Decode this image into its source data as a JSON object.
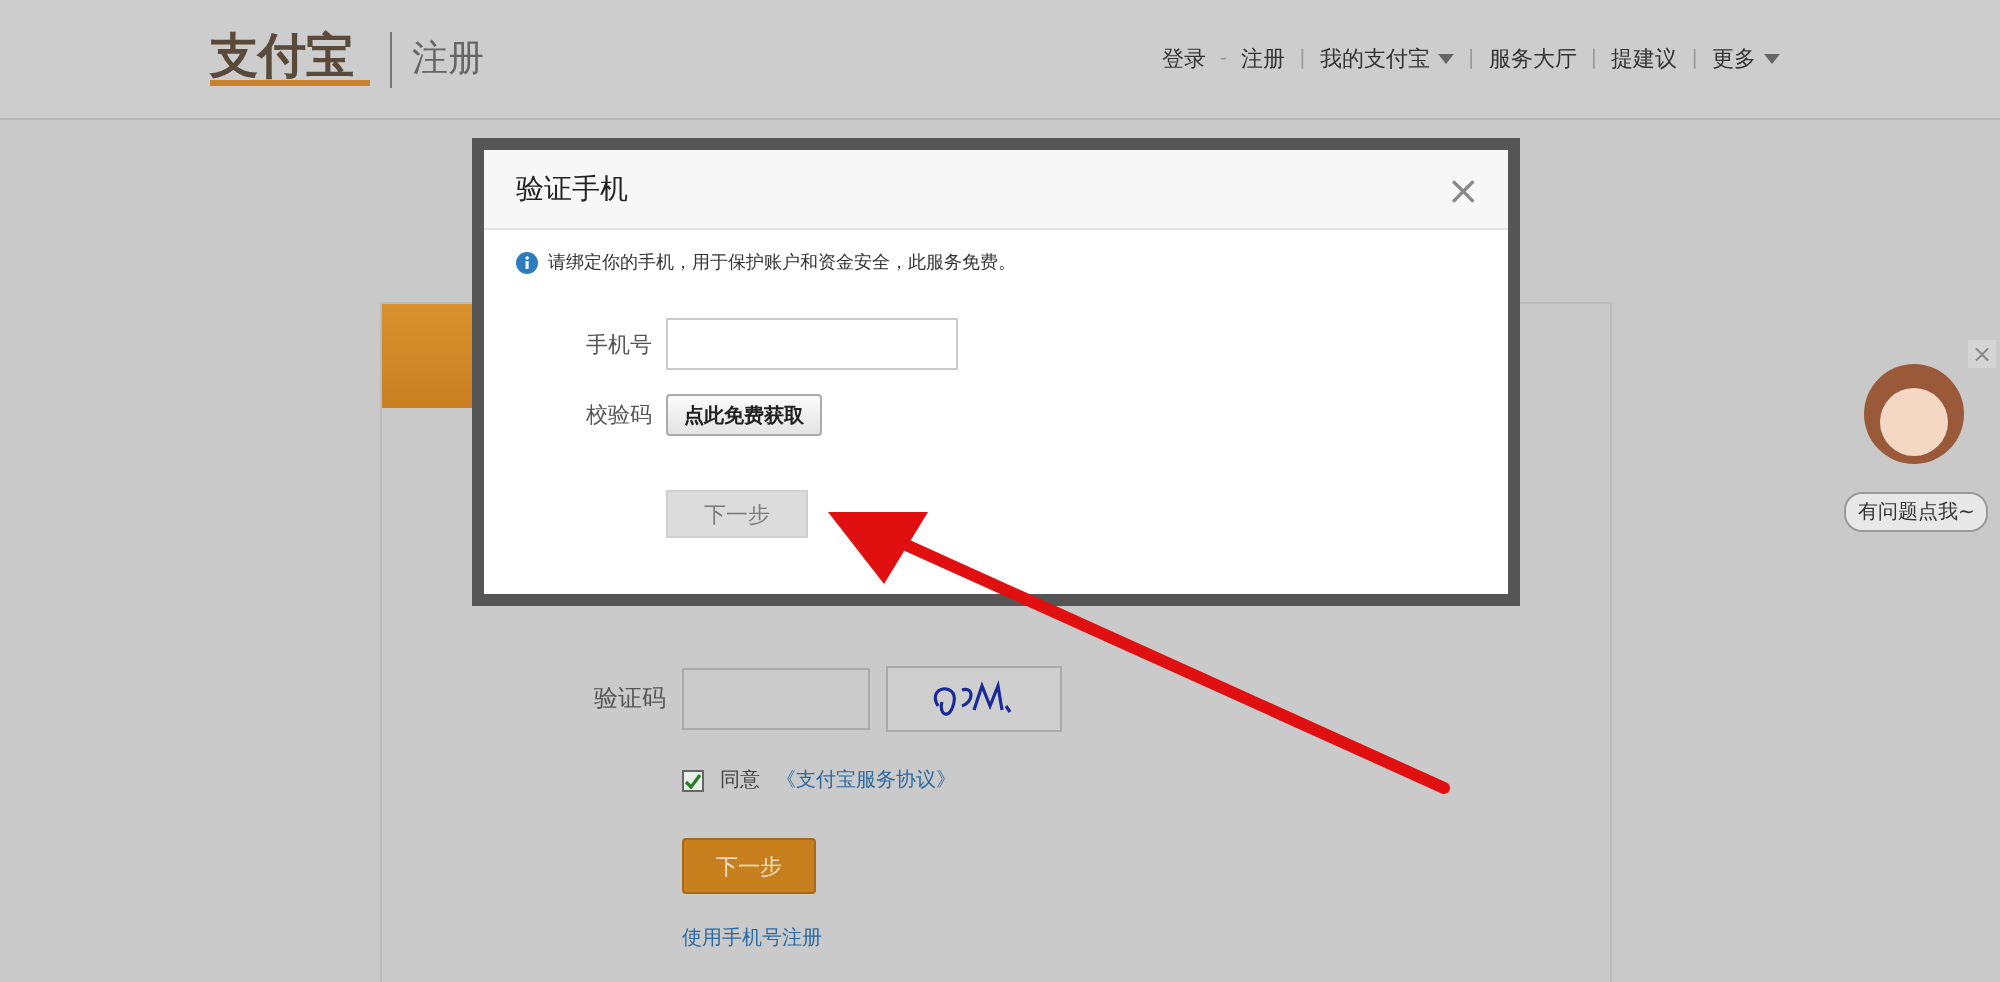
{
  "header": {
    "logo": "支付宝",
    "section": "注册",
    "nav": [
      {
        "label": "登录",
        "dropdown": false,
        "sep": "-"
      },
      {
        "label": "注册",
        "dropdown": false,
        "sep": "|"
      },
      {
        "label": "我的支付宝",
        "dropdown": true,
        "sep": "|"
      },
      {
        "label": "服务大厅",
        "dropdown": false,
        "sep": "|"
      },
      {
        "label": "提建议",
        "dropdown": false,
        "sep": "|"
      },
      {
        "label": "更多",
        "dropdown": true
      }
    ]
  },
  "form": {
    "captcha_label": "验证码",
    "agree": {
      "checked": true,
      "text": "同意",
      "link": "《支付宝服务协议》"
    },
    "submit": "下一步",
    "alt_link": "使用手机号注册"
  },
  "dialog": {
    "title": "验证手机",
    "close": "×",
    "notice": "请绑定你的手机，用于保护账户和资金安全，此服务免费。",
    "phone_label": "手机号",
    "code_label": "校验码",
    "code_button": "点此免费获取",
    "next": {
      "label": "下一步",
      "disabled": true
    }
  },
  "helper": {
    "close": "×",
    "bubble": "有问题点我~"
  }
}
